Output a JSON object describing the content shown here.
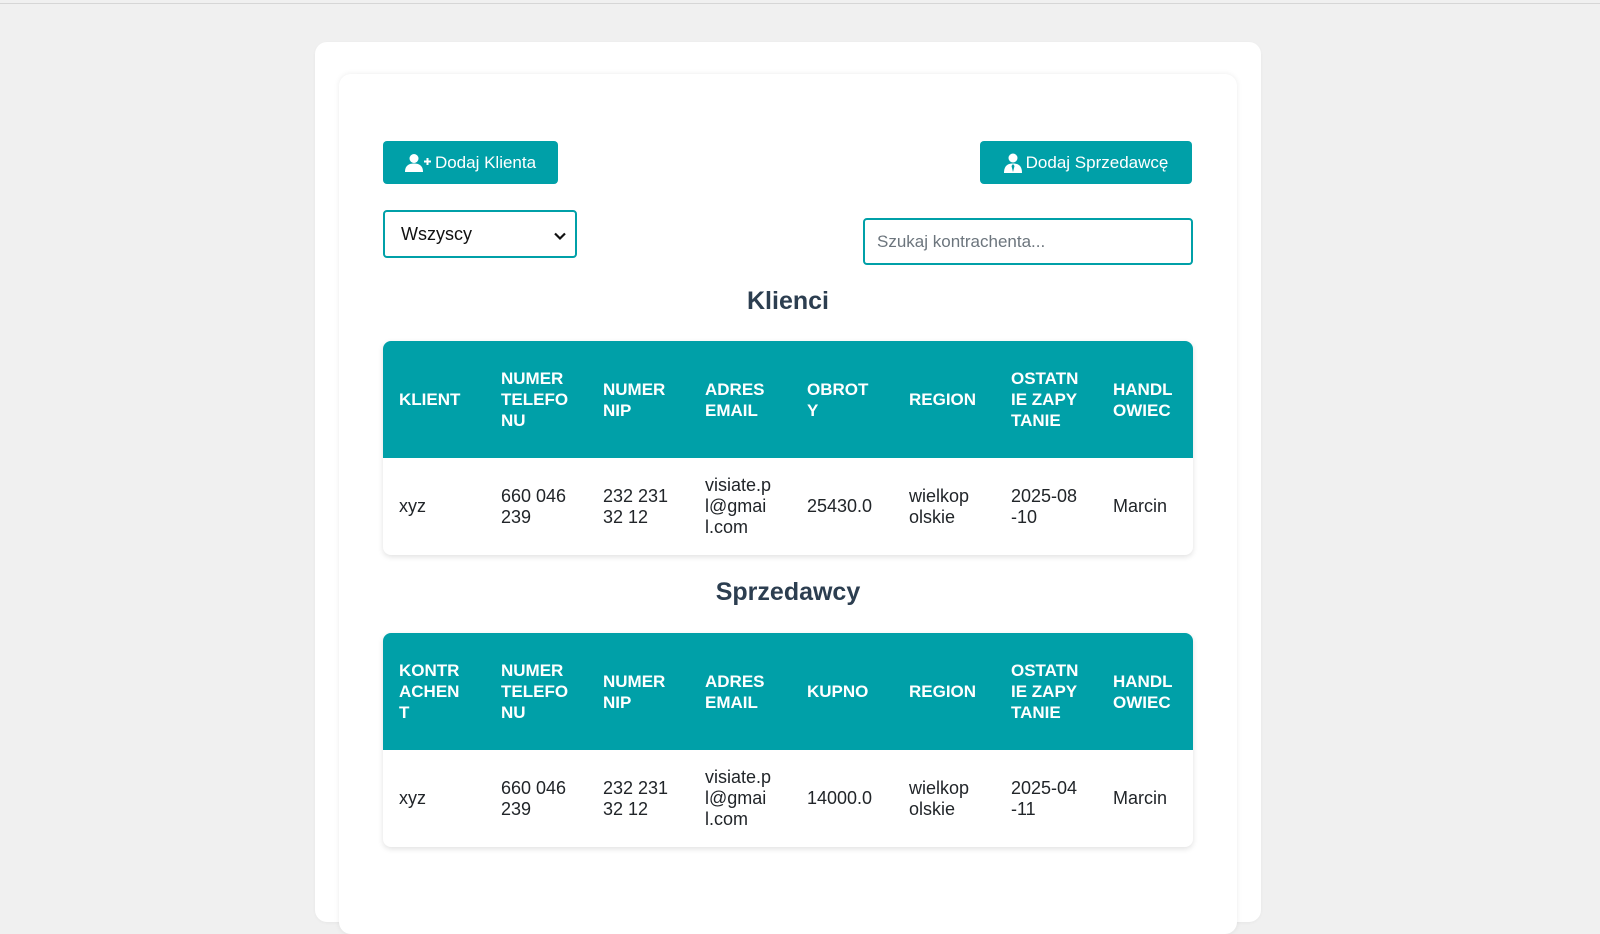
{
  "toolbar": {
    "add_client_label": "Dodaj Klienta",
    "add_seller_label": "Dodaj Sprzedawcę"
  },
  "filter": {
    "selected": "Wszyscy"
  },
  "search": {
    "placeholder": "Szukaj kontrachenta..."
  },
  "clients": {
    "title": "Klienci",
    "columns": [
      "KLIENT",
      "NUMER TELEFONU",
      "NUMER NIP",
      "ADRES EMAIL",
      "OBROTY",
      "REGION",
      "OSTATNIE ZAPYTANIE",
      "HANDLOWIEC"
    ],
    "rows": [
      [
        "xyz",
        "660 046 239",
        "232 231 32 12",
        "visiate.pl@gmail.com",
        "25430.0",
        "wielkopolskie",
        "2025-08-10",
        "Marcin"
      ]
    ]
  },
  "sellers": {
    "title": "Sprzedawcy",
    "columns": [
      "KONTRACHENT",
      "NUMER TELEFONU",
      "NUMER NIP",
      "ADRES EMAIL",
      "KUPNO",
      "REGION",
      "OSTATNIE ZAPYTANIE",
      "HANDLOWIEC"
    ],
    "rows": [
      [
        "xyz",
        "660 046 239",
        "232 231 32 12",
        "visiate.pl@gmail.com",
        "14000.0",
        "wielkopolskie",
        "2025-04-11",
        "Marcin"
      ]
    ]
  },
  "colors": {
    "accent": "#00a0a8",
    "title": "#2c3e50",
    "background": "#f0f0f0"
  },
  "icons": {
    "add_client": "user-plus-icon",
    "add_seller": "user-tie-icon",
    "select": "chevron-down-icon"
  }
}
